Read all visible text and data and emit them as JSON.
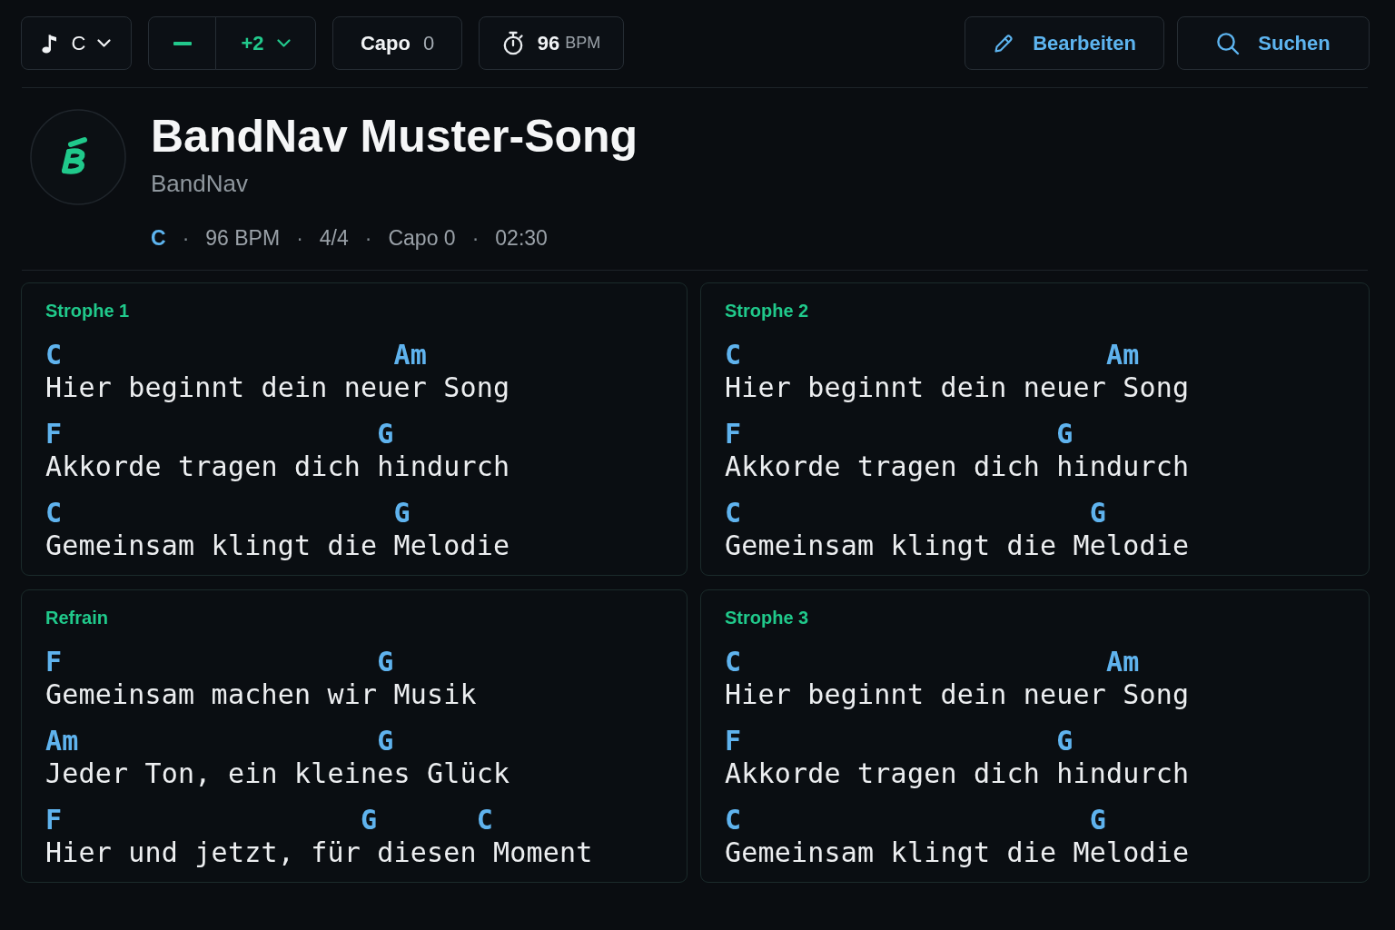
{
  "toolbar": {
    "key": {
      "label": "C"
    },
    "transpose": {
      "value": "+2"
    },
    "capo": {
      "label": "Capo",
      "value": "0"
    },
    "tempo": {
      "value": "96",
      "unit": "BPM"
    },
    "actions": [
      {
        "kind": "edit",
        "label": "Bearbeiten"
      },
      {
        "kind": "search",
        "label": "Suchen"
      }
    ]
  },
  "song": {
    "title": "BandNav Muster-Song",
    "artist": "BandNav",
    "meta": [
      {
        "kind": "key",
        "text": "C"
      },
      {
        "kind": "separator",
        "text": "·"
      },
      {
        "kind": "info",
        "text": "96 BPM"
      },
      {
        "kind": "separator",
        "text": "·"
      },
      {
        "kind": "info",
        "text": "4/4"
      },
      {
        "kind": "separator",
        "text": "·"
      },
      {
        "kind": "info",
        "text": "Capo 0"
      },
      {
        "kind": "separator",
        "text": "·"
      },
      {
        "kind": "info",
        "text": "02:30"
      }
    ]
  },
  "sections": [
    {
      "title": "Strophe 1",
      "lines": [
        {
          "chords": "C                    Am",
          "lyric": "Hier beginnt dein neuer Song"
        },
        {
          "chords": "F                   G",
          "lyric": "Akkorde tragen dich hindurch"
        },
        {
          "chords": "C                    G",
          "lyric": "Gemeinsam klingt die Melodie"
        }
      ]
    },
    {
      "title": "Strophe 2",
      "lines": [
        {
          "chords": "C                      Am",
          "lyric": "Hier beginnt dein neuer Song"
        },
        {
          "chords": "F                   G",
          "lyric": "Akkorde tragen dich hindurch"
        },
        {
          "chords": "C                     G",
          "lyric": "Gemeinsam klingt die Melodie"
        }
      ]
    },
    {
      "title": "Refrain",
      "lines": [
        {
          "chords": "F                   G",
          "lyric": "Gemeinsam machen wir Musik"
        },
        {
          "chords": "Am                  G",
          "lyric": "Jeder Ton, ein kleines Glück"
        },
        {
          "chords": "F                  G      C",
          "lyric": "Hier und jetzt, für diesen Moment"
        }
      ]
    },
    {
      "title": "Strophe 3",
      "lines": [
        {
          "chords": "C                      Am",
          "lyric": "Hier beginnt dein neuer Song"
        },
        {
          "chords": "F                   G",
          "lyric": "Akkorde tragen dich hindurch"
        },
        {
          "chords": "C                     G",
          "lyric": "Gemeinsam klingt die Melodie"
        }
      ]
    }
  ]
}
